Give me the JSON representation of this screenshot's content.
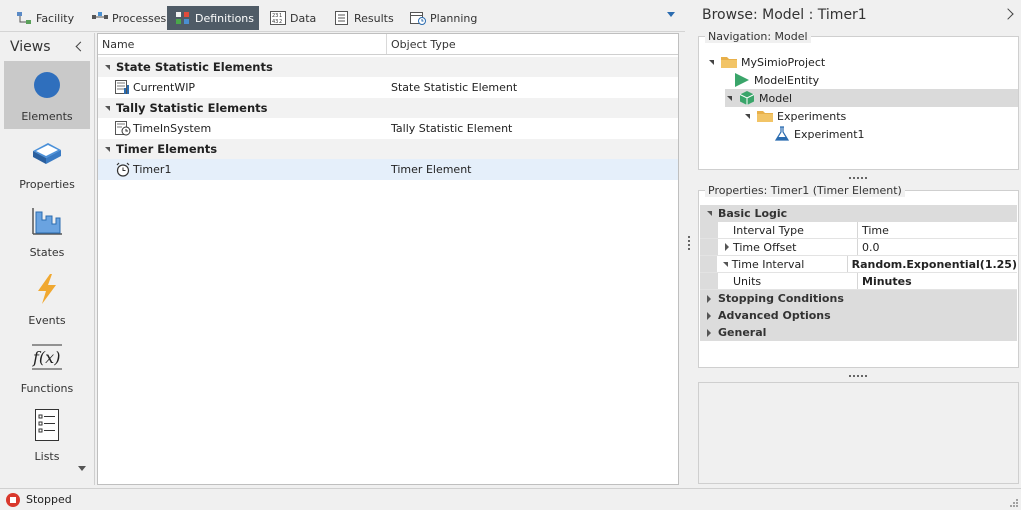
{
  "tabs": [
    {
      "label": "Facility",
      "icon": "facility-icon"
    },
    {
      "label": "Processes",
      "icon": "processes-icon"
    },
    {
      "label": "Definitions",
      "icon": "definitions-icon",
      "active": true
    },
    {
      "label": "Data",
      "icon": "data-table-icon"
    },
    {
      "label": "Results",
      "icon": "results-icon"
    },
    {
      "label": "Planning",
      "icon": "planning-icon"
    }
  ],
  "views": {
    "title": "Views",
    "items": [
      {
        "label": "Elements",
        "icon": "circle-icon",
        "active": true
      },
      {
        "label": "Properties",
        "icon": "properties-icon"
      },
      {
        "label": "States",
        "icon": "states-icon"
      },
      {
        "label": "Events",
        "icon": "lightning-icon"
      },
      {
        "label": "Functions",
        "icon": "function-icon",
        "glyph": "f(x)"
      },
      {
        "label": "Lists",
        "icon": "list-icon"
      }
    ]
  },
  "grid": {
    "columns": [
      "Name",
      "Object Type"
    ],
    "groups": [
      {
        "title": "State Statistic Elements",
        "rows": [
          {
            "name": "CurrentWIP",
            "type": "State Statistic Element",
            "icon": "state-statistic-icon"
          }
        ]
      },
      {
        "title": "Tally Statistic Elements",
        "rows": [
          {
            "name": "TimeInSystem",
            "type": "Tally Statistic Element",
            "icon": "tally-statistic-icon"
          }
        ]
      },
      {
        "title": "Timer Elements",
        "rows": [
          {
            "name": "Timer1",
            "type": "Timer Element",
            "icon": "timer-icon",
            "selected": true
          }
        ]
      }
    ]
  },
  "browse": {
    "title": "Browse: Model : Timer1",
    "navigation": {
      "legend": "Navigation: Model",
      "nodes": [
        {
          "label": "MySimioProject",
          "icon": "folder-icon"
        },
        {
          "label": "ModelEntity",
          "icon": "entity-icon"
        },
        {
          "label": "Model",
          "icon": "model-icon",
          "selected": true
        },
        {
          "label": "Experiments",
          "icon": "folder-icon"
        },
        {
          "label": "Experiment1",
          "icon": "flask-icon"
        }
      ]
    },
    "properties": {
      "legend": "Properties: Timer1 (Timer Element)",
      "basic_logic": "Basic Logic",
      "rows": [
        {
          "name": "Interval Type",
          "value": "Time",
          "bold": false,
          "expander": ""
        },
        {
          "name": "Time Offset",
          "value": "0.0",
          "bold": false,
          "expander": "collapsed"
        },
        {
          "name": "Time Interval",
          "value": "Random.Exponential(1.25)",
          "bold": true,
          "expander": "expanded"
        },
        {
          "name": "Units",
          "value": "Minutes",
          "bold": true,
          "expander": ""
        }
      ],
      "categories": [
        "Stopping Conditions",
        "Advanced Options",
        "General"
      ]
    }
  },
  "status": {
    "text": "Stopped"
  },
  "colors": {
    "accent": "#2b6cb0",
    "active_tab": "#4f5b66",
    "selected_row": "#e5effa",
    "stop": "#d9382c"
  }
}
